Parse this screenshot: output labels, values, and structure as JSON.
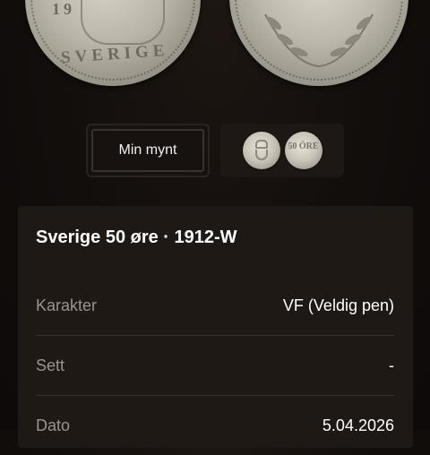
{
  "coin_left": {
    "year_text": "19",
    "country_text": "SVERIGE"
  },
  "selector": {
    "mine_label": "Min mynt",
    "reference_coin_text": "50 ÖRE"
  },
  "card": {
    "title": "Sverige 50 øre · 1912-W",
    "rows": [
      {
        "label": "Karakter",
        "value": "VF (Veldig pen)"
      },
      {
        "label": "Sett",
        "value": "-"
      },
      {
        "label": "Dato",
        "value": "5.04.2026"
      }
    ]
  },
  "colors": {
    "background": "#120e0c",
    "card": "#1f1915",
    "label": "#9a9490",
    "value": "#ffffff"
  }
}
